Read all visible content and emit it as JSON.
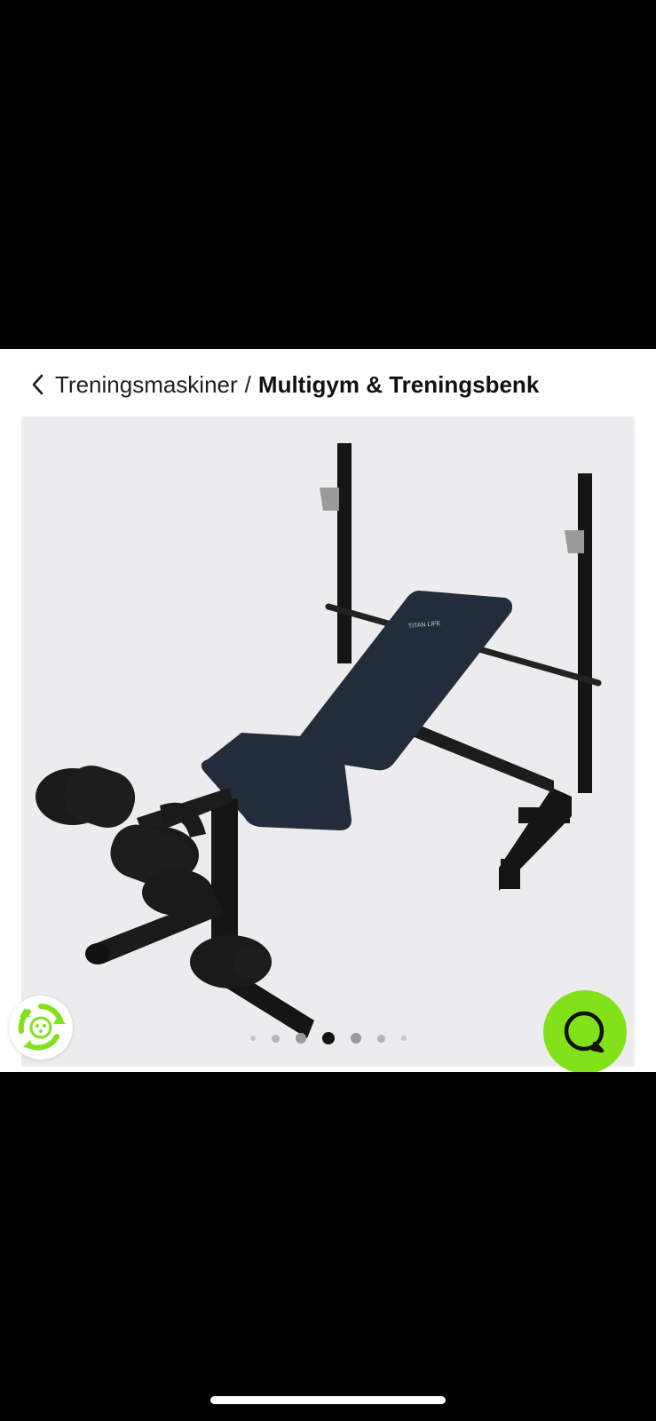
{
  "breadcrumb": {
    "back_icon": "chevron-left-icon",
    "parent": "Treningsmaskiner",
    "separator": "/",
    "current": "Multigym & Treningsbenk"
  },
  "gallery": {
    "image_subject": "weight-bench",
    "brand_on_seat": "TITAN LIFE",
    "dots_count": 7,
    "active_dot": 4
  },
  "badges": {
    "recycle_icon": "recycle-icon",
    "chat_icon": "chat-icon"
  },
  "colors": {
    "accent_green": "#82e21a",
    "gallery_bg": "#ececee"
  }
}
